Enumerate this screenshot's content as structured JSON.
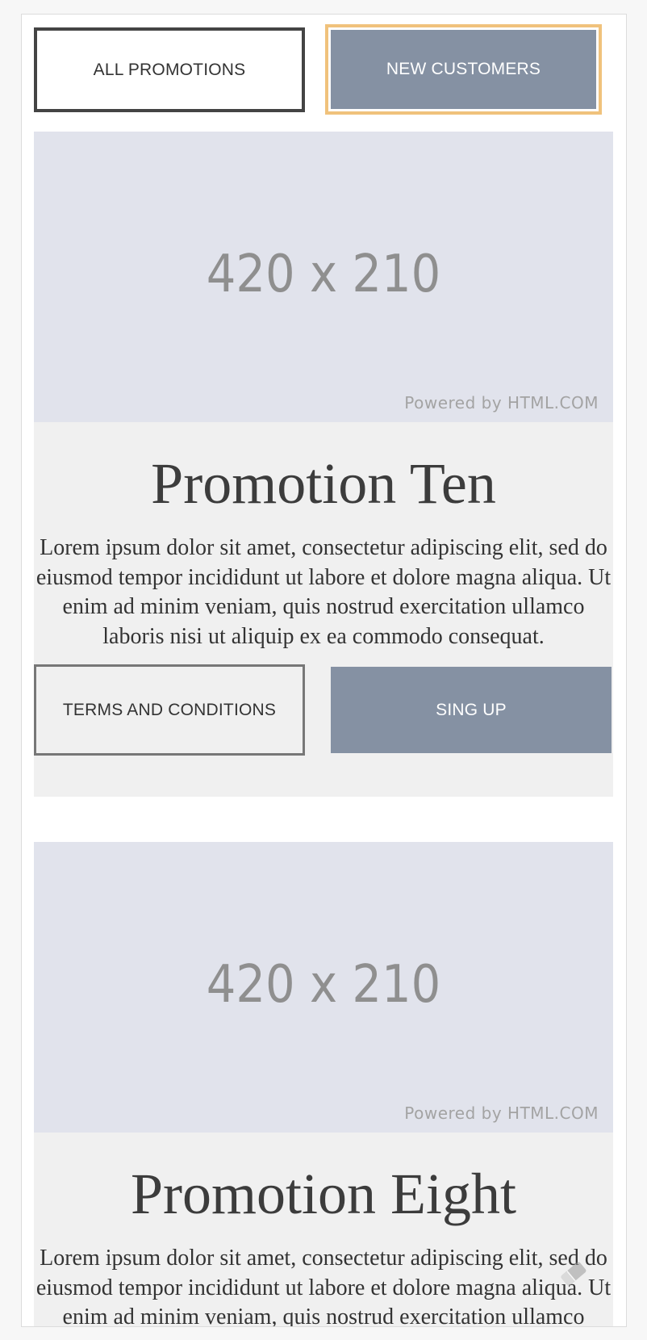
{
  "filters": {
    "all_label": "ALL PROMOTIONS",
    "new_customers_label": "NEW CUSTOMERS"
  },
  "promotions": [
    {
      "image_text": "420 x 210",
      "image_credit": "Powered by HTML.COM",
      "title": "Promotion Ten",
      "description": "Lorem ipsum dolor sit amet, consectetur adipiscing elit, sed do eiusmod tempor incididunt ut labore et dolore magna aliqua. Ut enim ad minim veniam, quis nostrud exercitation ullamco laboris nisi ut aliquip ex ea commodo consequat.",
      "terms_label": "TERMS AND CONDITIONS",
      "signup_label": "SING UP"
    },
    {
      "image_text": "420 x 210",
      "image_credit": "Powered by HTML.COM",
      "title": "Promotion Eight",
      "description": "Lorem ipsum dolor sit amet, consectetur adipiscing elit, sed do eiusmod tempor incididunt ut labore et dolore magna aliqua. Ut enim ad minim veniam, quis nostrud exercitation ullamco laboris nisi ut aliquip ex ea commodo consequat."
    }
  ],
  "colors": {
    "accent": "#8591a3",
    "focus_ring": "#f0c27c",
    "image_bg": "#e1e3ec",
    "card_bg": "#f0f0f0"
  },
  "icons": {
    "scroll_indicator": "eraser-icon"
  }
}
